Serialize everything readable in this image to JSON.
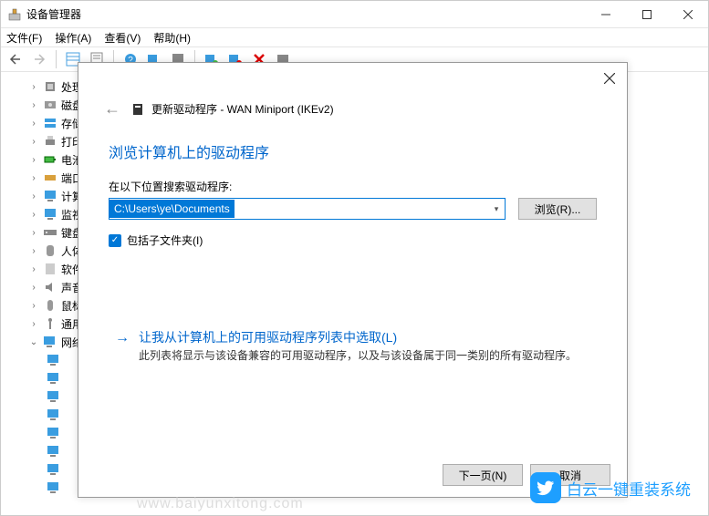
{
  "window": {
    "title": "设备管理器"
  },
  "menu": {
    "file": "文件(F)",
    "action": "操作(A)",
    "view": "查看(V)",
    "help": "帮助(H)"
  },
  "tree": {
    "items": [
      {
        "label": "处理",
        "icon": "cpu"
      },
      {
        "label": "磁盘",
        "icon": "disk"
      },
      {
        "label": "存储",
        "icon": "storage"
      },
      {
        "label": "打印",
        "icon": "printer"
      },
      {
        "label": "电池",
        "icon": "battery"
      },
      {
        "label": "端口",
        "icon": "port"
      },
      {
        "label": "计算",
        "icon": "computer"
      },
      {
        "label": "监视",
        "icon": "monitor"
      },
      {
        "label": "键盘",
        "icon": "keyboard"
      },
      {
        "label": "人体",
        "icon": "hid"
      },
      {
        "label": "软件",
        "icon": "software"
      },
      {
        "label": "声音",
        "icon": "sound"
      },
      {
        "label": "鼠标",
        "icon": "mouse"
      },
      {
        "label": "通用",
        "icon": "usb"
      }
    ],
    "net_label": "网络",
    "net_children_count": 8
  },
  "dialog": {
    "title_prefix": "更新驱动程序 - ",
    "device": "WAN Miniport (IKEv2)",
    "section_title": "浏览计算机上的驱动程序",
    "search_label": "在以下位置搜索驱动程序:",
    "path_value": "C:\\Users\\ye\\Documents",
    "browse": "浏览(R)...",
    "include_sub": "包括子文件夹(I)",
    "link_main": "让我从计算机上的可用驱动程序列表中选取(L)",
    "link_sub": "此列表将显示与该设备兼容的可用驱动程序，以及与该设备属于同一类别的所有驱动程序。",
    "next": "下一页(N)",
    "cancel": "取消"
  },
  "brand": {
    "watermark": "www.baiyunxitong.com",
    "logo_text": "白云一键重装系统"
  }
}
